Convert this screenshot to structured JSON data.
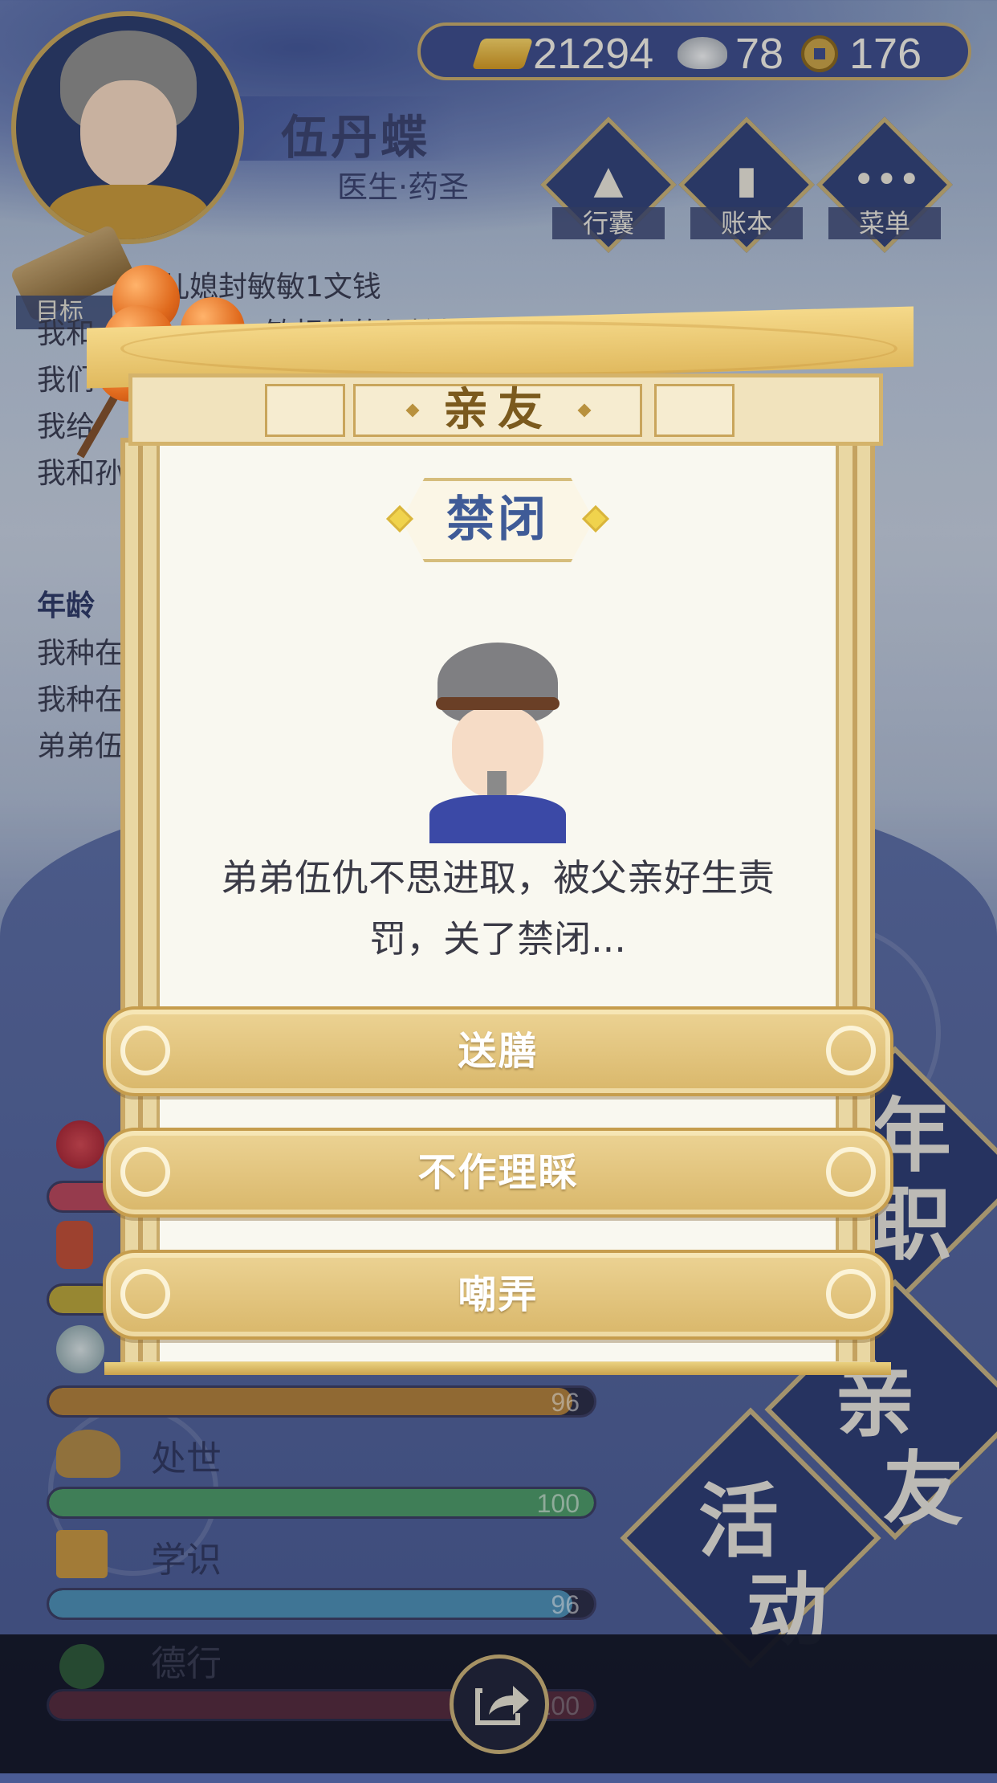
{
  "currency": {
    "gold": "21294",
    "silver": "78",
    "coins": "176"
  },
  "player": {
    "name": "伍丹蝶",
    "title": "医生·药圣"
  },
  "menu": [
    {
      "label": "行囊",
      "icon": "bag-icon"
    },
    {
      "label": "账本",
      "icon": "ledger-icon"
    },
    {
      "label": "菜单",
      "icon": "more-icon"
    }
  ],
  "target_label": "目标",
  "log": {
    "lines": [
      "儿媳封敏敏1文钱",
      "我和",
      "我们",
      "我给",
      "我和孙"
    ],
    "visible_fragment": "敏相处的很愉快",
    "section_header": "年龄",
    "lines2": [
      "我种在",
      "我种在",
      "弟弟伍"
    ]
  },
  "stats": [
    {
      "label": "",
      "value": "",
      "fill": 0.22,
      "color": "#b7485e",
      "icon": "flower-icon"
    },
    {
      "label": "",
      "value": "",
      "fill": 0.12,
      "color": "#b9a53e",
      "icon": "hydrant-icon"
    },
    {
      "label": "",
      "value": "96",
      "fill": 0.96,
      "color": "#b0813f",
      "icon": "mirror-icon"
    },
    {
      "label": "处世",
      "value": "100",
      "fill": 1.0,
      "color": "#4e9a6b",
      "icon": "shoe-icon"
    },
    {
      "label": "学识",
      "value": "96",
      "fill": 0.96,
      "color": "#4e8fb6",
      "icon": "books-icon"
    },
    {
      "label": "德行",
      "value": "100",
      "fill": 1.0,
      "color": "#8a3b4f",
      "icon": "coin-icon"
    }
  ],
  "side_tabs": [
    {
      "chars": [
        "年",
        "职"
      ]
    },
    {
      "chars": [
        "亲",
        "友"
      ]
    },
    {
      "chars": [
        "活",
        "动"
      ]
    }
  ],
  "modal": {
    "header": "亲友",
    "event_title": "禁闭",
    "description": "弟弟伍仇不思进取，被父亲好生责罚，关了禁闭...",
    "choices": [
      "送膳",
      "不作理睬",
      "嘲弄"
    ]
  },
  "colors": {
    "accent_gold": "#caa865",
    "navy": "#34457c",
    "panel": "#f9f8f0"
  }
}
